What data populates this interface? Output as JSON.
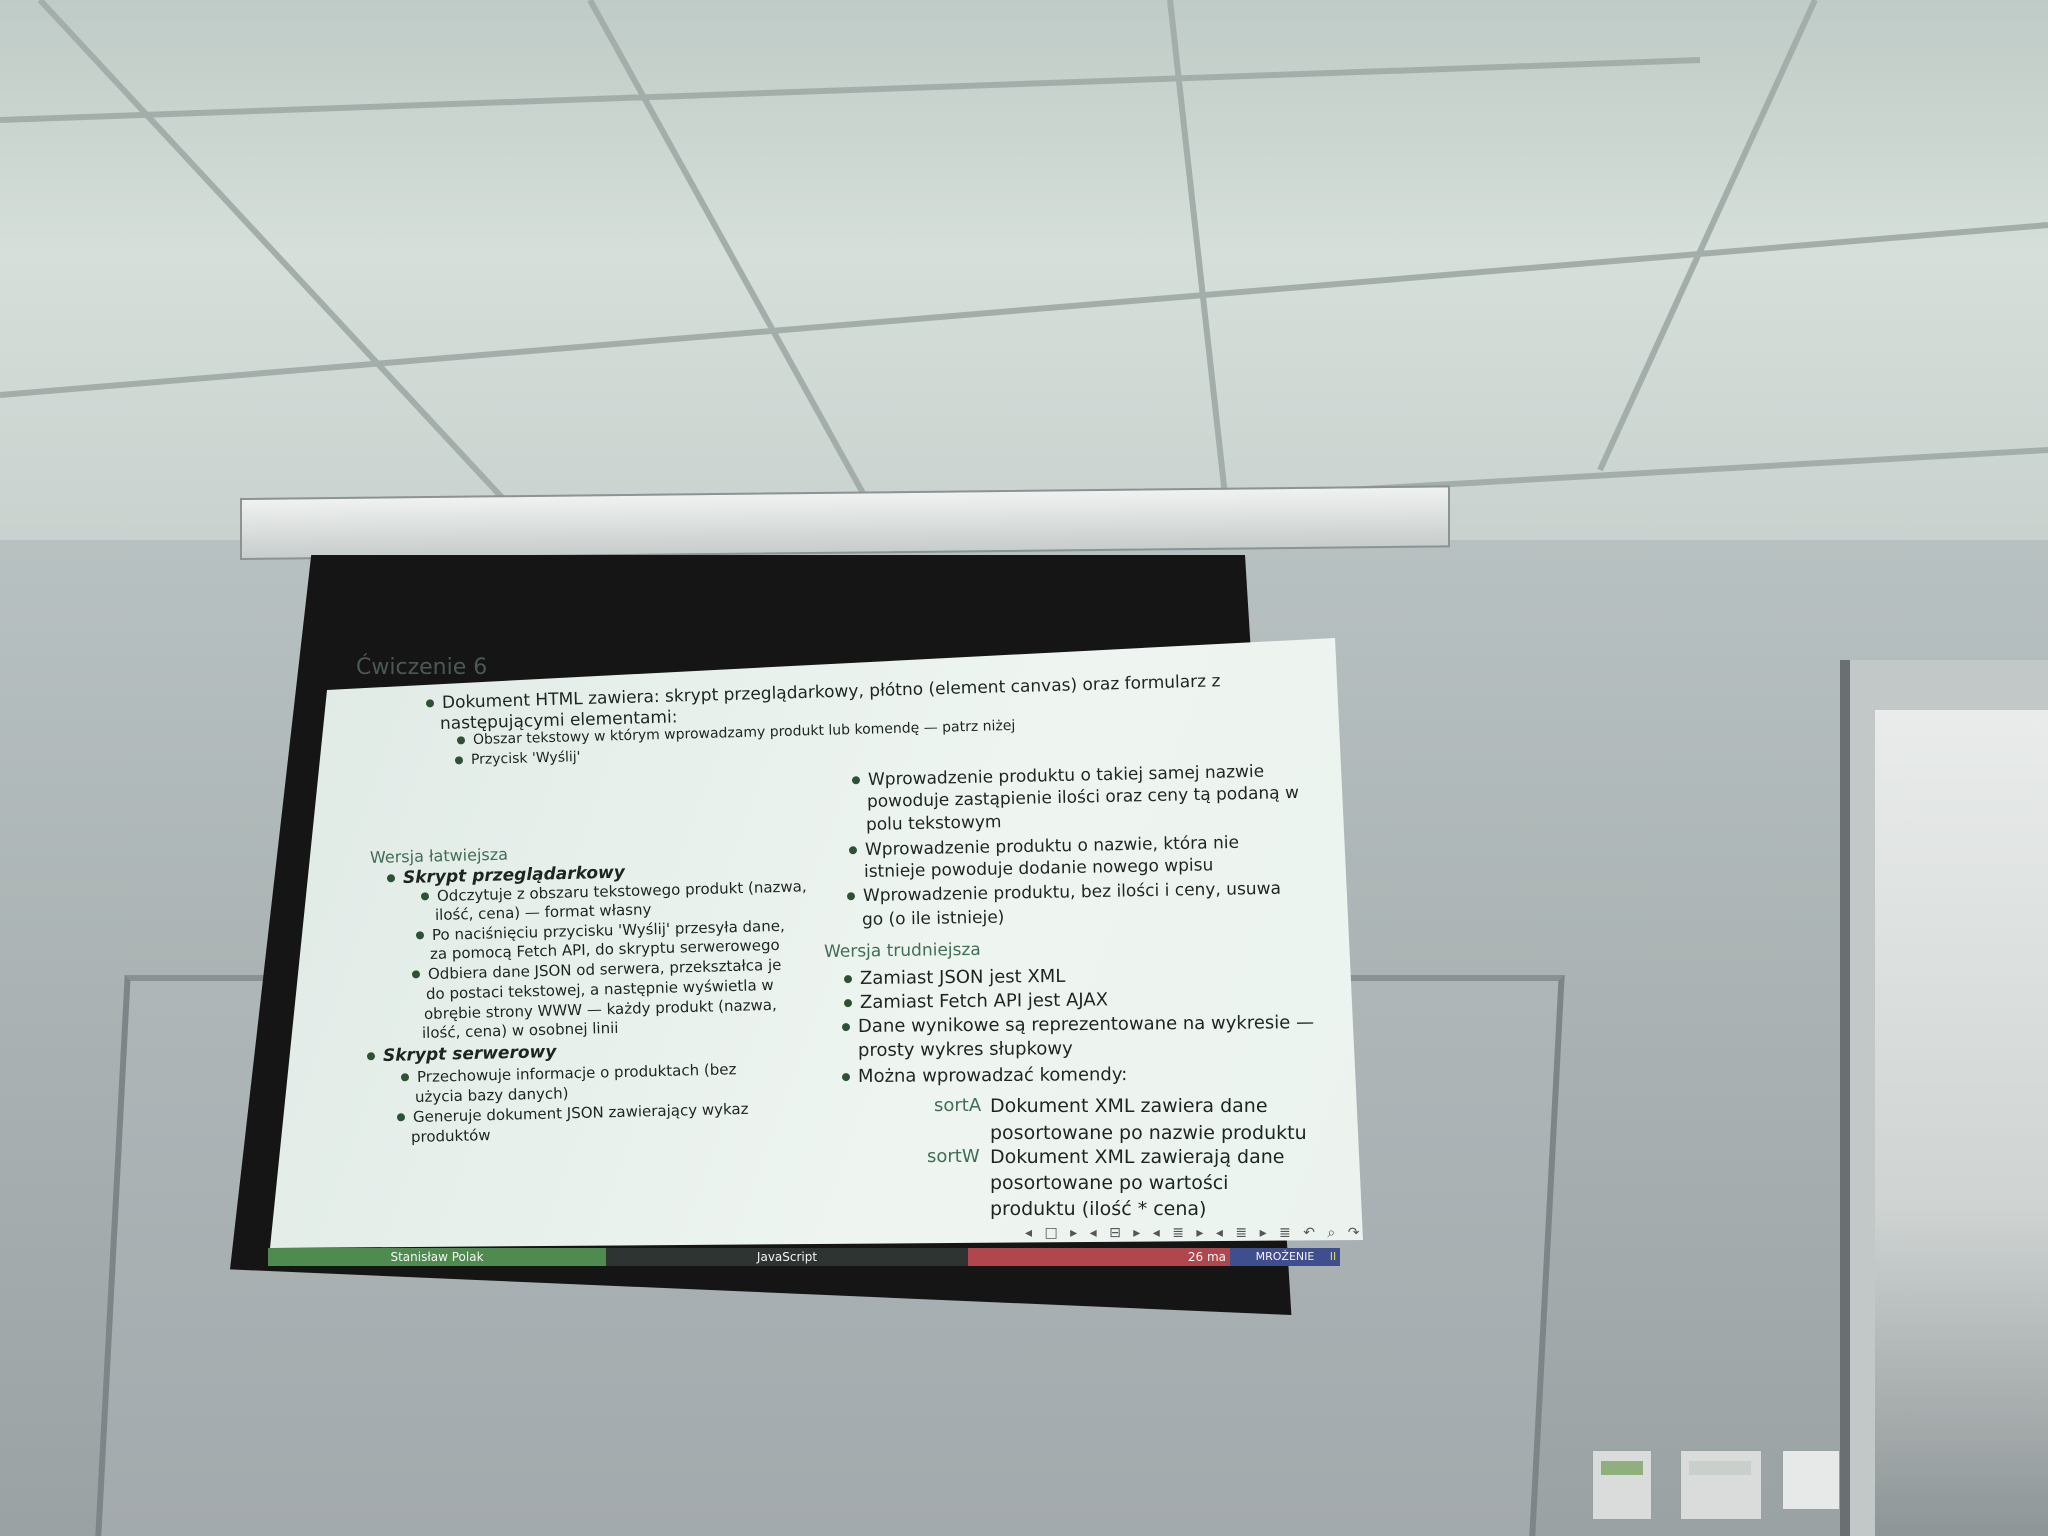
{
  "slide": {
    "title": "Ćwiczenie 6",
    "intro_line1": "Dokument HTML zawiera: skrypt przeglądarkowy, płótno (element canvas) oraz formularz z",
    "intro_line2": "następującymi elementami:",
    "intro_sub1": "Obszar tekstowy w którym wprowadzamy produkt lub komendę — patrz niżej",
    "intro_sub2": "Przycisk 'Wyślij'",
    "easy_heading": "Wersja łatwiejsza",
    "browser_script": "Skrypt przeglądarkowy",
    "bs_items": [
      [
        "Odczytuje z obszaru tekstowego produkt (nazwa,",
        "ilość, cena) — format własny"
      ],
      [
        "Po naciśnięciu przycisku 'Wyślij' przesyła dane,",
        "za pomocą Fetch API, do skryptu serwerowego"
      ],
      [
        "Odbiera dane JSON od serwera, przekształca je",
        "do postaci tekstowej, a następnie wyświetla w",
        "obrębie strony WWW — każdy produkt (nazwa,",
        "ilość, cena) w osobnej linii"
      ]
    ],
    "server_script": "Skrypt serwerowy",
    "ss_items": [
      [
        "Przechowuje informacje o produktach (bez",
        "użycia bazy danych)"
      ],
      [
        "Generuje dokument JSON zawierający wykaz",
        "produktów"
      ]
    ],
    "right_items": [
      [
        "Wprowadzenie produktu o takiej samej nazwie",
        "powoduje zastąpienie ilości oraz ceny tą podaną w",
        "polu tekstowym"
      ],
      [
        "Wprowadzenie produktu o nazwie, która nie",
        "istnieje powoduje dodanie nowego wpisu"
      ],
      [
        "Wprowadzenie produktu, bez ilości i ceny, usuwa",
        "go (o ile istnieje)"
      ]
    ],
    "hard_heading": "Wersja trudniejsza",
    "hard_items": [
      [
        "Zamiast JSON jest XML"
      ],
      [
        "Zamiast Fetch API jest AJAX"
      ],
      [
        "Dane wynikowe są reprezentowane na wykresie —",
        "prosty wykres słupkowy"
      ],
      [
        "Można wprowadzać komendy:"
      ]
    ],
    "commands": [
      {
        "name": "sortA",
        "desc": [
          "Dokument XML zawiera dane",
          "posortowane po nazwie produktu"
        ]
      },
      {
        "name": "sortW",
        "desc": [
          "Dokument XML zawierają dane",
          "posortowane po wartości",
          "produktu (ilość * cena)"
        ]
      }
    ],
    "footer": {
      "author": "Stanisław Polak",
      "subject": "JavaScript",
      "date": "26 ma",
      "freeze": "MROŻENIE",
      "pause": "II"
    },
    "nav": "◂ □ ▸ ◂ ⊟ ▸ ◂ ≣ ▸ ◂ ≣ ▸   ≣   ↶ ⌕ ↷"
  },
  "colors": {
    "footer_green": "#4f8a4f",
    "footer_dark": "#2d3431",
    "footer_red": "#b0474f",
    "footer_blue": "#3f4e8f"
  }
}
